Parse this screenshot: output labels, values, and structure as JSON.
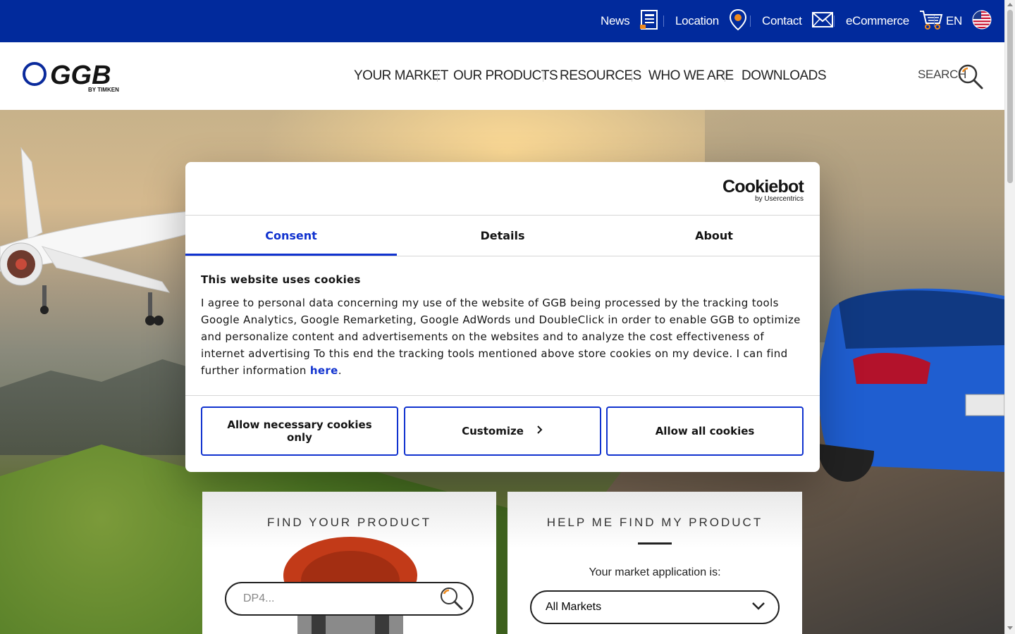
{
  "topbar": {
    "items": [
      {
        "label": "News",
        "icon": "news-icon"
      },
      {
        "label": "Location",
        "icon": "location-pin-icon"
      },
      {
        "label": "Contact",
        "icon": "envelope-icon"
      },
      {
        "label": "eCommerce",
        "icon": "cart-icon"
      },
      {
        "label": "EN",
        "icon": "us-flag-icon"
      }
    ],
    "background": "#012a9c"
  },
  "header": {
    "logo_text": "GGB",
    "logo_sub": "BY TIMKEN",
    "nav": [
      "YOUR MARKET",
      "OUR PRODUCTS",
      "RESOURCES",
      "WHO WE ARE",
      "DOWNLOADS"
    ],
    "search_label": "SEARCH"
  },
  "cookie_dialog": {
    "brand": "Cookiebot",
    "brand_sub": "by Usercentrics",
    "tabs": [
      "Consent",
      "Details",
      "About"
    ],
    "active_tab": "Consent",
    "heading": "This website uses cookies",
    "body": "I agree to personal data concerning my use of the website of GGB being processed by the tracking tools Google Analytics, Google Remarketing, Google AdWords und DoubleClick in order to enable GGB to optimize and personalize content and advertisements on the websites and to analyze the cost effectiveness of internet advertising To this end the tracking tools mentioned above store cookies on my device. I can find further information ",
    "link_text": "here",
    "body_end": ".",
    "buttons": {
      "necessary": "Allow necessary cookies only",
      "customize": "Customize",
      "allow_all": "Allow all cookies"
    },
    "accent": "#1032cf"
  },
  "find_product": {
    "title": "FIND YOUR PRODUCT",
    "search_placeholder": "DP4..."
  },
  "help_find": {
    "title": "HELP ME FIND MY PRODUCT",
    "question": "Your market application is:",
    "selected_market": "All Markets"
  }
}
